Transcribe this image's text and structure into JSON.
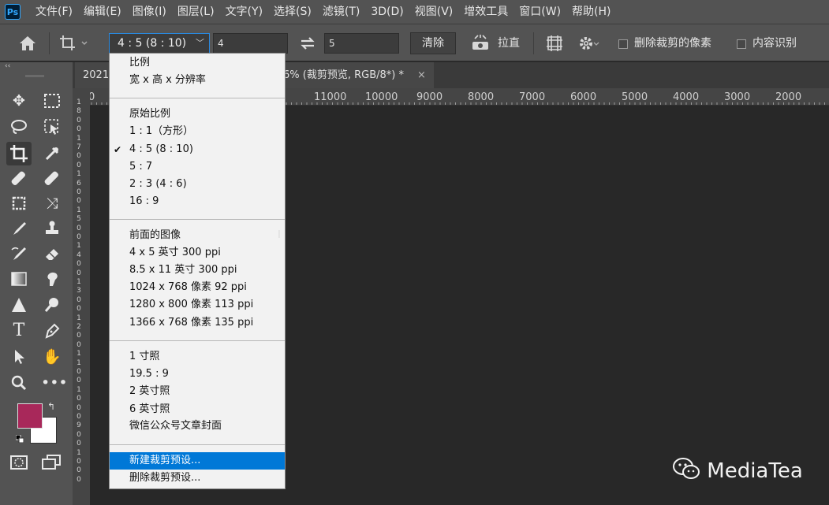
{
  "app": {
    "logo": "Ps"
  },
  "menu": [
    "文件(F)",
    "编辑(E)",
    "图像(I)",
    "图层(L)",
    "文字(Y)",
    "选择(S)",
    "滤镜(T)",
    "3D(D)",
    "视图(V)",
    "增效工具",
    "窗口(W)",
    "帮助(H)"
  ],
  "options": {
    "ratio_value": "4 : 5 (8 : 10)",
    "width_value": "4",
    "height_value": "5",
    "clear_label": "清除",
    "straighten_label": "拉直",
    "delete_cropped_label": "删除裁剪的像素",
    "content_aware_label": "内容识别"
  },
  "tabs": {
    "tab1": "2021",
    "tab2": "6% (裁剪预览, RGB/8*) *",
    "close": "×"
  },
  "ruler": {
    "h_labels": [
      "0",
      "11000",
      "10000",
      "9000",
      "8000",
      "7000",
      "6000",
      "5000",
      "4000",
      "3000",
      "2000"
    ],
    "v_labels": [
      "1",
      "8",
      "0",
      "0",
      "1",
      "7",
      "0",
      "0",
      "1",
      "6",
      "0",
      "0",
      "1",
      "5",
      "0",
      "0",
      "1",
      "4",
      "0",
      "0",
      "1",
      "3",
      "0",
      "0",
      "1",
      "2",
      "0",
      "0",
      "1",
      "1",
      "0",
      "0",
      "1",
      "0",
      "0",
      "0",
      "9",
      "0",
      "0",
      "1",
      "0",
      "0",
      "0"
    ]
  },
  "dropdown": {
    "group1": [
      "比例",
      "宽 x 高 x 分辨率"
    ],
    "group2": [
      "原始比例",
      "1 : 1（方形）",
      "4 : 5 (8 : 10)",
      "5 : 7",
      "2 : 3 (4 : 6)",
      "16 : 9"
    ],
    "group3": [
      "前面的图像",
      "4 x 5 英寸 300 ppi",
      "8.5 x 11 英寸 300 ppi",
      "1024 x 768 像素 92 ppi",
      "1280 x 800 像素 113 ppi",
      "1366 x 768 像素 135 ppi"
    ],
    "group4": [
      "1 寸照",
      "19.5 : 9",
      "2 英寸照",
      "6 英寸照",
      "微信公众号文章封面"
    ],
    "group5": [
      "新建裁剪预设...",
      "删除裁剪预设..."
    ],
    "checkmark": "✔"
  },
  "colors": {
    "foreground": "#a8285a",
    "background": "#ffffff",
    "highlight": "#0078d7"
  },
  "watermark": "MediaTea"
}
